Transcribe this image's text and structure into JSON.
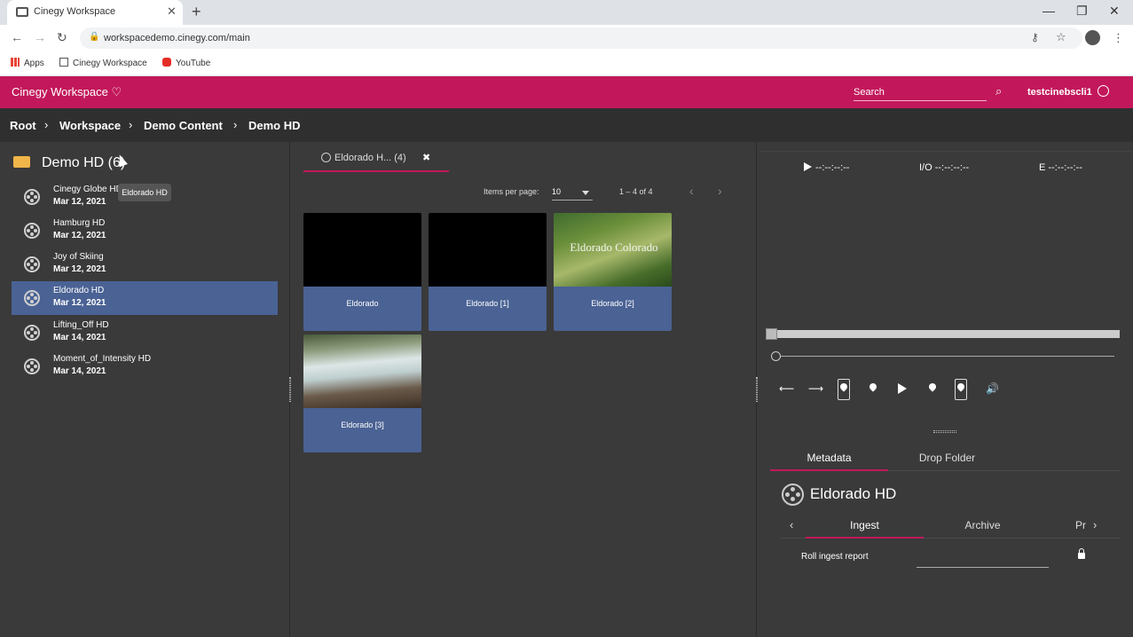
{
  "browser": {
    "tab_title": "Cinegy Workspace",
    "url": "workspacedemo.cinegy.com/main",
    "bookmarks": [
      "Apps",
      "Cinegy Workspace",
      "YouTube"
    ]
  },
  "app": {
    "brand": "Cinegy Workspace",
    "search_placeholder": "Search",
    "username": "testcinebscli1",
    "accent_color": "#c2185b",
    "selection_color": "#4a6294"
  },
  "breadcrumb": [
    "Root",
    "Workspace",
    "Demo Content",
    "Demo HD"
  ],
  "sidebar": {
    "folder_title": "Demo HD (6)",
    "items": [
      {
        "name": "Cinegy Globe HD",
        "date": "Mar 12, 2021"
      },
      {
        "name": "Hamburg HD",
        "date": "Mar 12, 2021"
      },
      {
        "name": "Joy of Skiing",
        "date": "Mar 12, 2021"
      },
      {
        "name": "Eldorado HD",
        "date": "Mar 12, 2021"
      },
      {
        "name": "Lifting_Off HD",
        "date": "Mar 14, 2021"
      },
      {
        "name": "Moment_of_Intensity HD",
        "date": "Mar 14, 2021"
      }
    ],
    "tooltip": "Eldorado HD"
  },
  "bin": {
    "tab_label": "Eldorado H... (4)",
    "items_per_page_label": "Items per page:",
    "items_per_page": "10",
    "range": "1 – 4 of 4",
    "cards": [
      {
        "caption": "Eldorado",
        "thumb": "black"
      },
      {
        "caption": "Eldorado [1]",
        "thumb": "black"
      },
      {
        "caption": "Eldorado [2]",
        "thumb": "forest",
        "overlay": "Eldorado Colorado"
      },
      {
        "caption": "Eldorado [3]",
        "thumb": "river"
      }
    ]
  },
  "player": {
    "tc_position": "--:--:--:--",
    "tc_io": "I/O --:--:--:--",
    "tc_end": "E --:--:--:--"
  },
  "metadata": {
    "tabs": [
      "Metadata",
      "Drop Folder"
    ],
    "title": "Eldorado HD",
    "subtabs": [
      "Ingest",
      "Archive",
      "Pr"
    ],
    "field_label": "Roll ingest report",
    "field_value": ""
  }
}
